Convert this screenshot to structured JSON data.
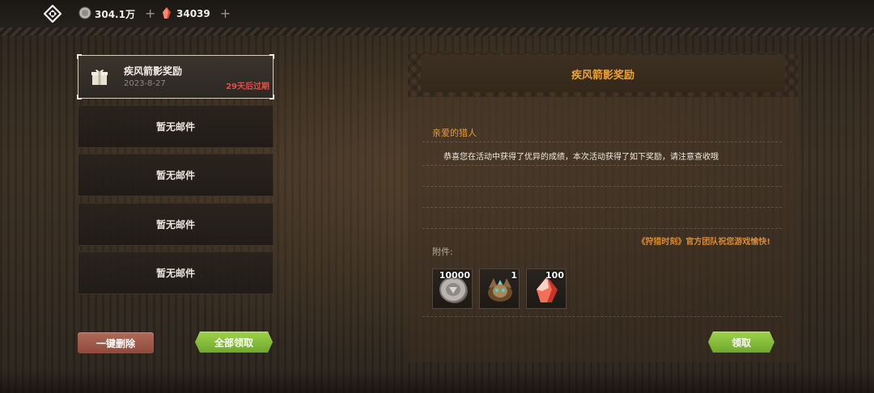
{
  "topbar": {
    "logo_icon": "diamond-logo-icon",
    "currencies": [
      {
        "icon": "silver-coin-icon",
        "value": "304.1万"
      },
      {
        "icon": "red-crystal-icon",
        "value": "34039"
      }
    ]
  },
  "mail_list": {
    "selected": {
      "icon": "gift-box-icon",
      "title": "疾风箭影奖励",
      "date": "2023-8-27",
      "expire": "29天后过期"
    },
    "empty_slots": [
      "暂无邮件",
      "暂无邮件",
      "暂无邮件",
      "暂无邮件"
    ]
  },
  "left_buttons": {
    "delete_all": "一键删除",
    "claim_all": "全部领取"
  },
  "mail_detail": {
    "title": "疾风箭影奖励",
    "greeting": "亲爱的猎人",
    "body": "恭喜您在活动中获得了优异的成绩，本次活动获得了如下奖励，请注意查收哦",
    "signature": "《狩猎时刻》官方团队祝您游戏愉快!",
    "attachments_label": "附件:",
    "attachments": [
      {
        "icon": "silver-coin-icon",
        "qty": "10000"
      },
      {
        "icon": "beast-mask-icon",
        "qty": "1"
      },
      {
        "icon": "red-crystal-icon",
        "qty": "100"
      }
    ],
    "claim_button": "领取"
  },
  "colors": {
    "accent_orange": "#f0a430",
    "expire_red": "#e0504a",
    "button_green": "#8cc63f",
    "button_red": "#a05a4a"
  }
}
